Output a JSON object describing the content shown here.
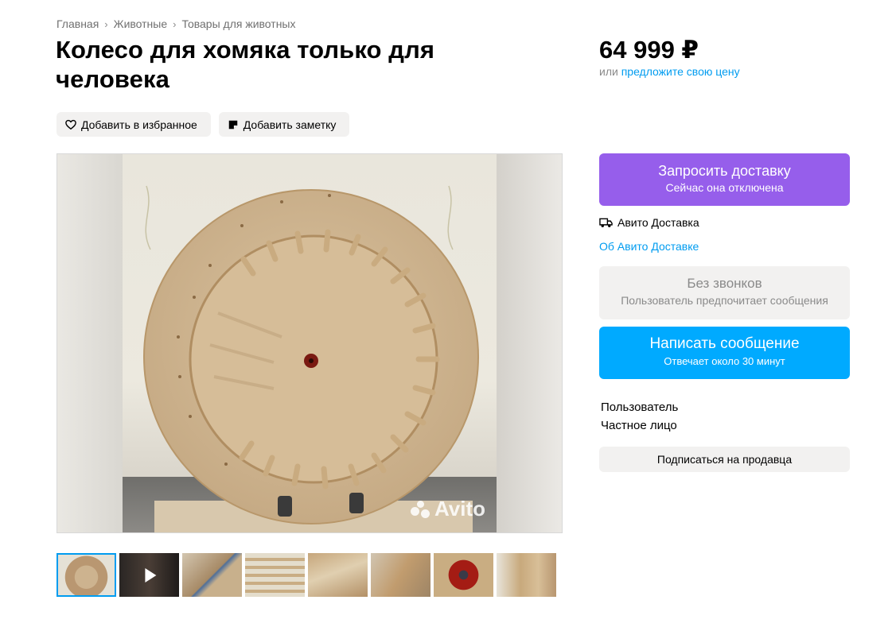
{
  "breadcrumb": {
    "items": [
      "Главная",
      "Животные",
      "Товары для животных"
    ],
    "separator": "›"
  },
  "listing": {
    "title": "Колесо для хомяка только для человека",
    "price": "64 999 ₽",
    "offer_prefix": "или",
    "offer_link": "предложите свою цену"
  },
  "actions": {
    "favorite": "Добавить в избранное",
    "note": "Добавить заметку"
  },
  "gallery": {
    "watermark": "Avito",
    "thumbnail_count": 8,
    "active_index": 0,
    "video_thumbnail_index": 1
  },
  "delivery": {
    "button_label": "Запросить доставку",
    "button_sub": "Сейчас она отключена",
    "service_label": "Авито Доставка",
    "about_link": "Об Авито Доставке"
  },
  "contact": {
    "no_calls_label": "Без звонков",
    "no_calls_sub": "Пользователь предпочитает сообщения",
    "message_label": "Написать сообщение",
    "message_sub": "Отвечает около 30 минут"
  },
  "seller": {
    "name": "Пользователь",
    "type": "Частное лицо",
    "subscribe_label": "Подписаться на продавца"
  },
  "colors": {
    "accent_blue": "#00aaff",
    "link_blue": "#009cf0",
    "delivery_purple": "#965eeb",
    "pill_bg": "#f2f1f0"
  }
}
